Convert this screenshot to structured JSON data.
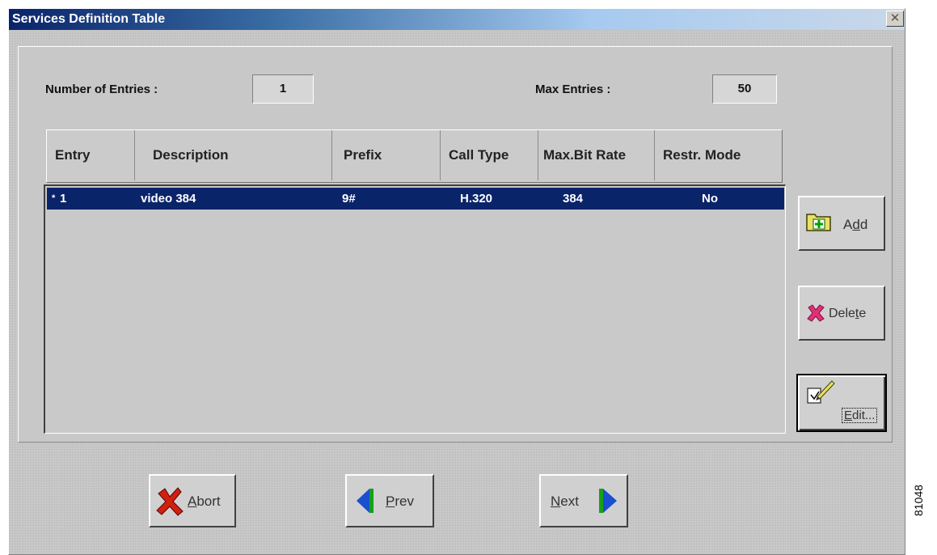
{
  "window": {
    "title": "Services Definition Table",
    "close_glyph": "✕"
  },
  "summary": {
    "entries_label": "Number of Entries :",
    "entries_value": "1",
    "max_label": "Max Entries :",
    "max_value": "50"
  },
  "table": {
    "columns": [
      "Entry",
      "Description",
      "Prefix",
      "Call Type",
      "Max.Bit Rate",
      "Restr. Mode"
    ],
    "rows": [
      {
        "marker": "*",
        "entry": "1",
        "description": "video 384",
        "prefix": "9#",
        "call_type": "H.320",
        "max_bit_rate": "384",
        "restr_mode": "No"
      }
    ]
  },
  "side_buttons": {
    "add_pre": "A",
    "add_u": "d",
    "add_post": "d",
    "delete_pre": "Dele",
    "delete_u": "t",
    "delete_post": "e",
    "edit_pre": "",
    "edit_u": "E",
    "edit_post": "dit..."
  },
  "bottom_buttons": {
    "abort_u": "A",
    "abort_post": "bort",
    "prev_u": "P",
    "prev_post": "rev",
    "next_u": "N",
    "next_post": "ext"
  },
  "figure_id": "81048",
  "icons": [
    "close-icon",
    "add-folder-icon",
    "delete-x-icon",
    "edit-pencil-icon",
    "abort-x-icon",
    "prev-arrow-icon",
    "next-arrow-icon"
  ]
}
